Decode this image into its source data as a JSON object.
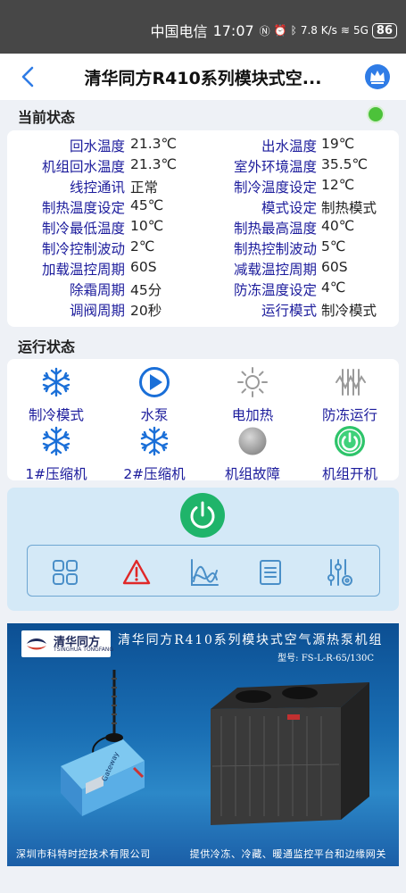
{
  "status_bar": {
    "carrier": "中国电信",
    "time": "17:07",
    "network_speed": "7.8 K/s",
    "signal": "5G",
    "battery": "86"
  },
  "header": {
    "title": "清华同方R410系列模块式空...",
    "back_icon": "back-arrow-icon",
    "vip_icon": "crown-icon"
  },
  "current_status": {
    "title": "当前状态",
    "online_color": "#4cc23a",
    "rows": [
      {
        "l1": "回水温度",
        "v1": "21.3℃",
        "l2": "出水温度",
        "v2": "19℃"
      },
      {
        "l1": "机组回水温度",
        "v1": "21.3℃",
        "l2": "室外环境温度",
        "v2": "35.5℃"
      },
      {
        "l1": "线控通讯",
        "v1": "正常",
        "l2": "制冷温度设定",
        "v2": "12℃"
      },
      {
        "l1": "制热温度设定",
        "v1": "45℃",
        "l2": "模式设定",
        "v2": "制热模式"
      },
      {
        "l1": "制冷最低温度",
        "v1": "10℃",
        "l2": "制热最高温度",
        "v2": "40℃"
      },
      {
        "l1": "制冷控制波动",
        "v1": "2℃",
        "l2": "制热控制波动",
        "v2": "5℃"
      },
      {
        "l1": "加载温控周期",
        "v1": "60S",
        "l2": "减载温控周期",
        "v2": "60S"
      },
      {
        "l1": "除霜周期",
        "v1": "45分",
        "l2": "防冻温度设定",
        "v2": "4℃"
      },
      {
        "l1": "调阀周期",
        "v1": "20秒",
        "l2": "运行模式",
        "v2": "制冷模式"
      }
    ]
  },
  "run_status": {
    "title": "运行状态",
    "items": [
      {
        "label": "制冷模式",
        "icon": "snowflake-icon",
        "active": true
      },
      {
        "label": "水泵",
        "icon": "play-circle-icon",
        "active": true
      },
      {
        "label": "电加热",
        "icon": "sun-icon",
        "active": false
      },
      {
        "label": "防冻运行",
        "icon": "antifreeze-icon",
        "active": false
      },
      {
        "label": "1#压缩机",
        "icon": "snowflake-icon",
        "active": true
      },
      {
        "label": "2#压缩机",
        "icon": "snowflake-icon",
        "active": true
      },
      {
        "label": "机组故障",
        "icon": "fault-dot-icon",
        "active": false
      },
      {
        "label": "机组开机",
        "icon": "power-on-icon",
        "active": true
      }
    ]
  },
  "control": {
    "power_icon": "power-icon",
    "tools": [
      "grid-icon",
      "warning-icon",
      "chart-icon",
      "list-icon",
      "settings-icon"
    ]
  },
  "banner": {
    "logo_name": "清华同方",
    "logo_en": "TSINGHUA TONGFANG",
    "title": "清华同方R410系列模块式空气源热泵机组",
    "model": "型号: FS-L-R-65/130C",
    "company": "深圳市科特时控技术有限公司",
    "service": "提供冷冻、冷藏、暖通监控平台和边缘网关",
    "device_label": "Gateway"
  }
}
